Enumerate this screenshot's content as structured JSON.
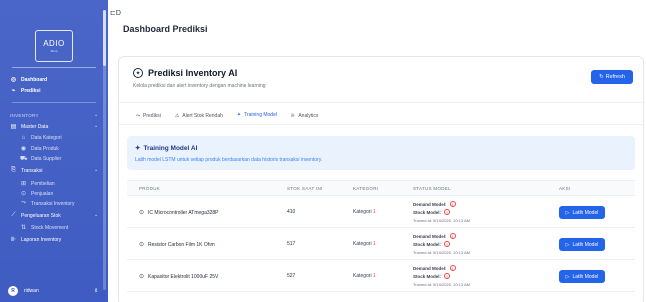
{
  "sidebar": {
    "logo_text": "ADIO",
    "logo_sub": "Shop",
    "items": [
      {
        "label": "Dashboard",
        "icon": "gauge-icon"
      },
      {
        "label": "Prediksi",
        "icon": "chart-icon"
      }
    ],
    "section_inventory": "INVENTORY",
    "master_data": "Master Data",
    "master_children": [
      "Data Kategori",
      "Data Produk",
      "Data Supplier"
    ],
    "transaksi": "Transaksi",
    "transaksi_children": [
      "Pembelian",
      "Penjualan",
      "Transaksi Inventory"
    ],
    "pengeluaran": "Pengeluaran Stok",
    "pengeluaran_children": [
      "Stock Movement"
    ],
    "laporan": "Laporan Inventory",
    "user_initial": "R",
    "user_name": "ridwan"
  },
  "header": {
    "collapse_glyph": "⊏D",
    "title": "Dashboard Prediksi"
  },
  "card": {
    "title": "Prediksi Inventory AI",
    "subtitle": "Kelola prediksi dan alert inventory dengan machine learning",
    "refresh_label": "Refresh"
  },
  "tabs": [
    {
      "label": "Prediksi",
      "icon": "trend-icon",
      "active": false
    },
    {
      "label": "Alert Stok Rendah",
      "icon": "warning-icon",
      "active": false
    },
    {
      "label": "Training Model",
      "icon": "brain-icon",
      "active": true
    },
    {
      "label": "Analytics",
      "icon": "bar-chart-icon",
      "active": false
    }
  ],
  "info": {
    "title": "Training Model AI",
    "text": "Latih model LSTM untuk setiap produk berdasarkan data historis transaksi inventory."
  },
  "table": {
    "headers": [
      "PRODUK",
      "STOK SAAT INI",
      "KATEGORI",
      "STATUS MODEL",
      "AKSI"
    ],
    "rows": [
      {
        "product": "IC Microcontroller ATmega328P",
        "stock": "410",
        "kategori_label": "Kategori",
        "kategori_num": "1",
        "demand": "Demand Model:",
        "stock_model": "Stock Model:",
        "trained": "Trained at: 5/19/2025, 10:13 AM",
        "action": "Latih Model"
      },
      {
        "product": "Resistor Carbon Film 1K Ohm",
        "stock": "517",
        "kategori_label": "Kategori",
        "kategori_num": "1",
        "demand": "Demand Model:",
        "stock_model": "Stock Model:",
        "trained": "Trained at: 5/19/2025, 10:13 AM",
        "action": "Latih Model"
      },
      {
        "product": "Kapasitor Elektrolit 1000uF 25V",
        "stock": "527",
        "kategori_label": "Kategori",
        "kategori_num": "1",
        "demand": "Demand Model:",
        "stock_model": "Stock Model:",
        "trained": "Trained at: 5/19/2025, 10:13 AM",
        "action": "Latih Model"
      }
    ]
  },
  "colors": {
    "sidebar": "#4062c4",
    "primary": "#2563eb",
    "info_bg": "#eaf2fd",
    "warning": "#ef4444"
  }
}
